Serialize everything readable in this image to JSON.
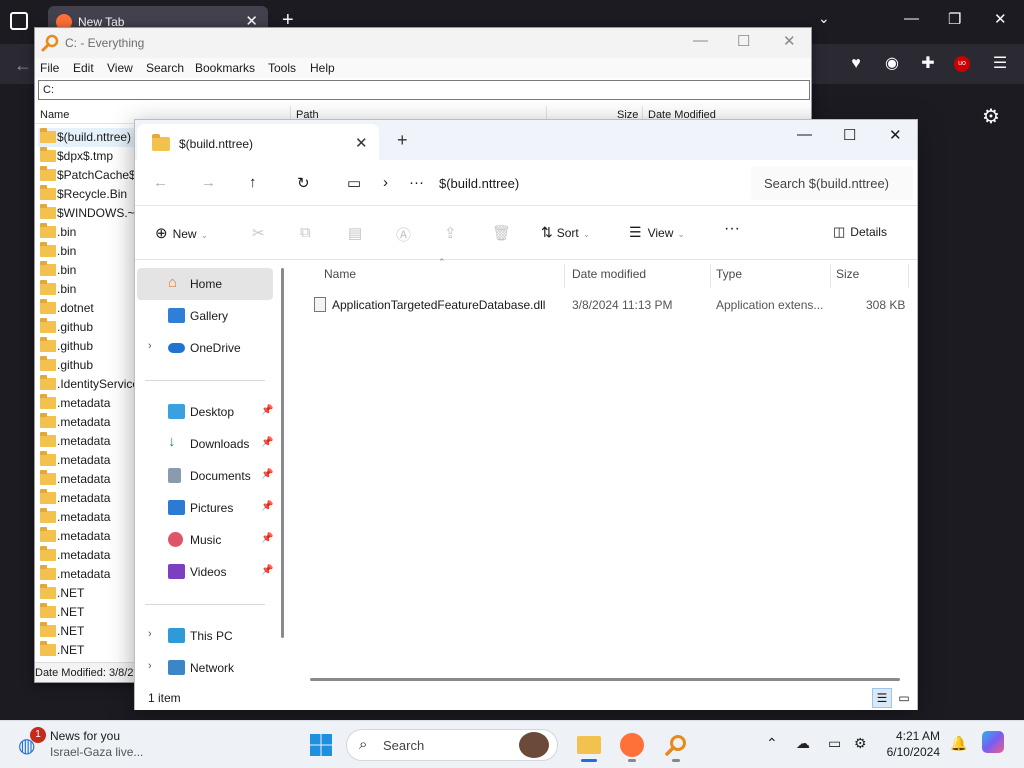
{
  "browser": {
    "tab_title": "New Tab",
    "colors": {
      "bg": "#1c1b22",
      "tab": "#42414d",
      "toolbar": "#2b2a33"
    }
  },
  "everything": {
    "title": "C: - Everything",
    "menu": [
      "File",
      "Edit",
      "View",
      "Search",
      "Bookmarks",
      "Tools",
      "Help"
    ],
    "search_value": "C:",
    "columns": [
      "Name",
      "Path",
      "Size",
      "Date Modified"
    ],
    "rows": [
      "$(build.nttree)",
      "$dpx$.tmp",
      "$PatchCache$",
      "$Recycle.Bin",
      "$WINDOWS.~BT",
      ".bin",
      ".bin",
      ".bin",
      ".bin",
      ".dotnet",
      ".github",
      ".github",
      ".github",
      ".IdentityService",
      ".metadata",
      ".metadata",
      ".metadata",
      ".metadata",
      ".metadata",
      ".metadata",
      ".metadata",
      ".metadata",
      ".metadata",
      ".metadata",
      ".NET",
      ".NET",
      ".NET",
      ".NET"
    ],
    "status": "Date Modified: 3/8/2"
  },
  "explorer": {
    "tab_title": "$(build.nttree)",
    "breadcrumb": "$(build.nttree)",
    "search_placeholder": "Search $(build.nttree)",
    "commands": {
      "new": "New",
      "sort": "Sort",
      "view": "View",
      "details": "Details"
    },
    "nav": {
      "home": "Home",
      "gallery": "Gallery",
      "onedrive": "OneDrive",
      "desktop": "Desktop",
      "downloads": "Downloads",
      "documents": "Documents",
      "pictures": "Pictures",
      "music": "Music",
      "videos": "Videos",
      "thispc": "This PC",
      "network": "Network"
    },
    "columns": {
      "name": "Name",
      "date": "Date modified",
      "type": "Type",
      "size": "Size"
    },
    "files": [
      {
        "name": "ApplicationTargetedFeatureDatabase.dll",
        "date": "3/8/2024 11:13 PM",
        "type": "Application extens...",
        "size": "308 KB"
      }
    ],
    "status": "1 item"
  },
  "taskbar": {
    "news_badge": "1",
    "news_title": "News for you",
    "news_sub": "Israel-Gaza live...",
    "search_label": "Search",
    "time": "4:21 AM",
    "date": "6/10/2024",
    "accent": "#1f6fd6"
  }
}
